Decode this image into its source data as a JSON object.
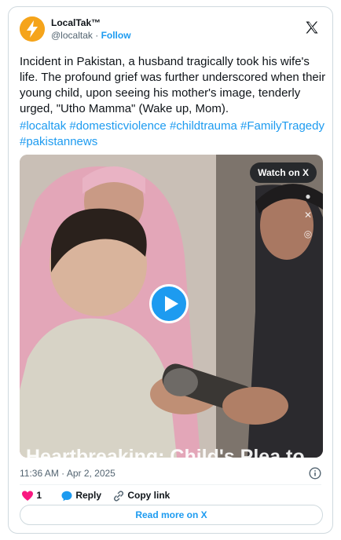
{
  "account": {
    "display_name": "LocalTak™",
    "handle": "@localtak",
    "separator": "·",
    "follow_label": "Follow"
  },
  "tweet": {
    "text": "Incident in Pakistan, a husband tragically took his wife's life. The profound grief was further underscored when their young child, upon seeing his mother's image, tenderly urged, \"Utho Mamma\" (Wake up, Mom).",
    "hashtags": [
      "#localtak",
      "#domesticviolence",
      "#childtrauma",
      "#FamilyTragedy",
      "#pakistannews"
    ]
  },
  "media": {
    "watch_label": "Watch on X",
    "caption": "Heartbreaking: Child's Plea to"
  },
  "meta": {
    "timestamp": "11:36 AM · Apr 2, 2025"
  },
  "actions": {
    "like_count": "1",
    "reply_label": "Reply",
    "copy_label": "Copy link"
  },
  "footer": {
    "read_more_label": "Read more on X"
  },
  "colors": {
    "accent": "#1d9bf0",
    "like": "#f91880",
    "text": "#0f1419",
    "secondary": "#536471"
  }
}
